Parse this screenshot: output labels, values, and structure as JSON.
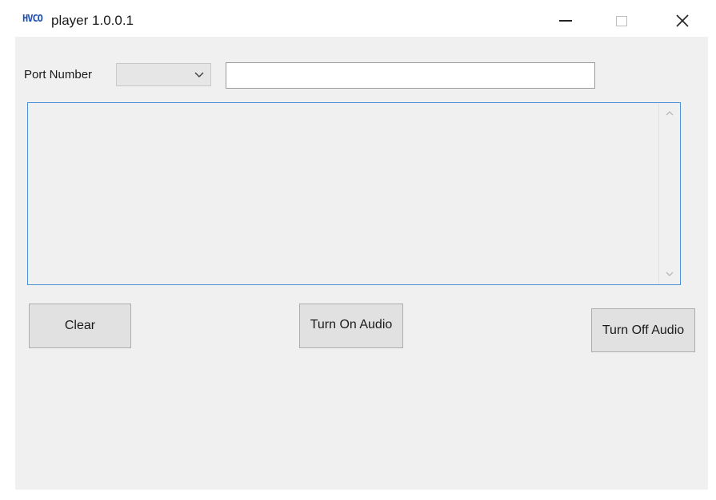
{
  "window": {
    "logo_text": "HVCO",
    "title": "player 1.0.0.1"
  },
  "controls": {
    "minimize_icon": "minimize-icon",
    "maximize_icon": "maximize-icon",
    "close_icon": "close-icon"
  },
  "port": {
    "label": "Port Number",
    "selected_value": ""
  },
  "text_input": {
    "value": "",
    "placeholder": ""
  },
  "log": {
    "text": ""
  },
  "buttons": {
    "clear": "Clear",
    "turn_on_audio": "Turn On Audio",
    "turn_off_audio": "Turn Off Audio"
  },
  "colors": {
    "client_bg": "#f0f0f0",
    "focus_border": "#4a90d9",
    "button_bg": "#e1e1e1",
    "logo": "#1f4fb0"
  }
}
